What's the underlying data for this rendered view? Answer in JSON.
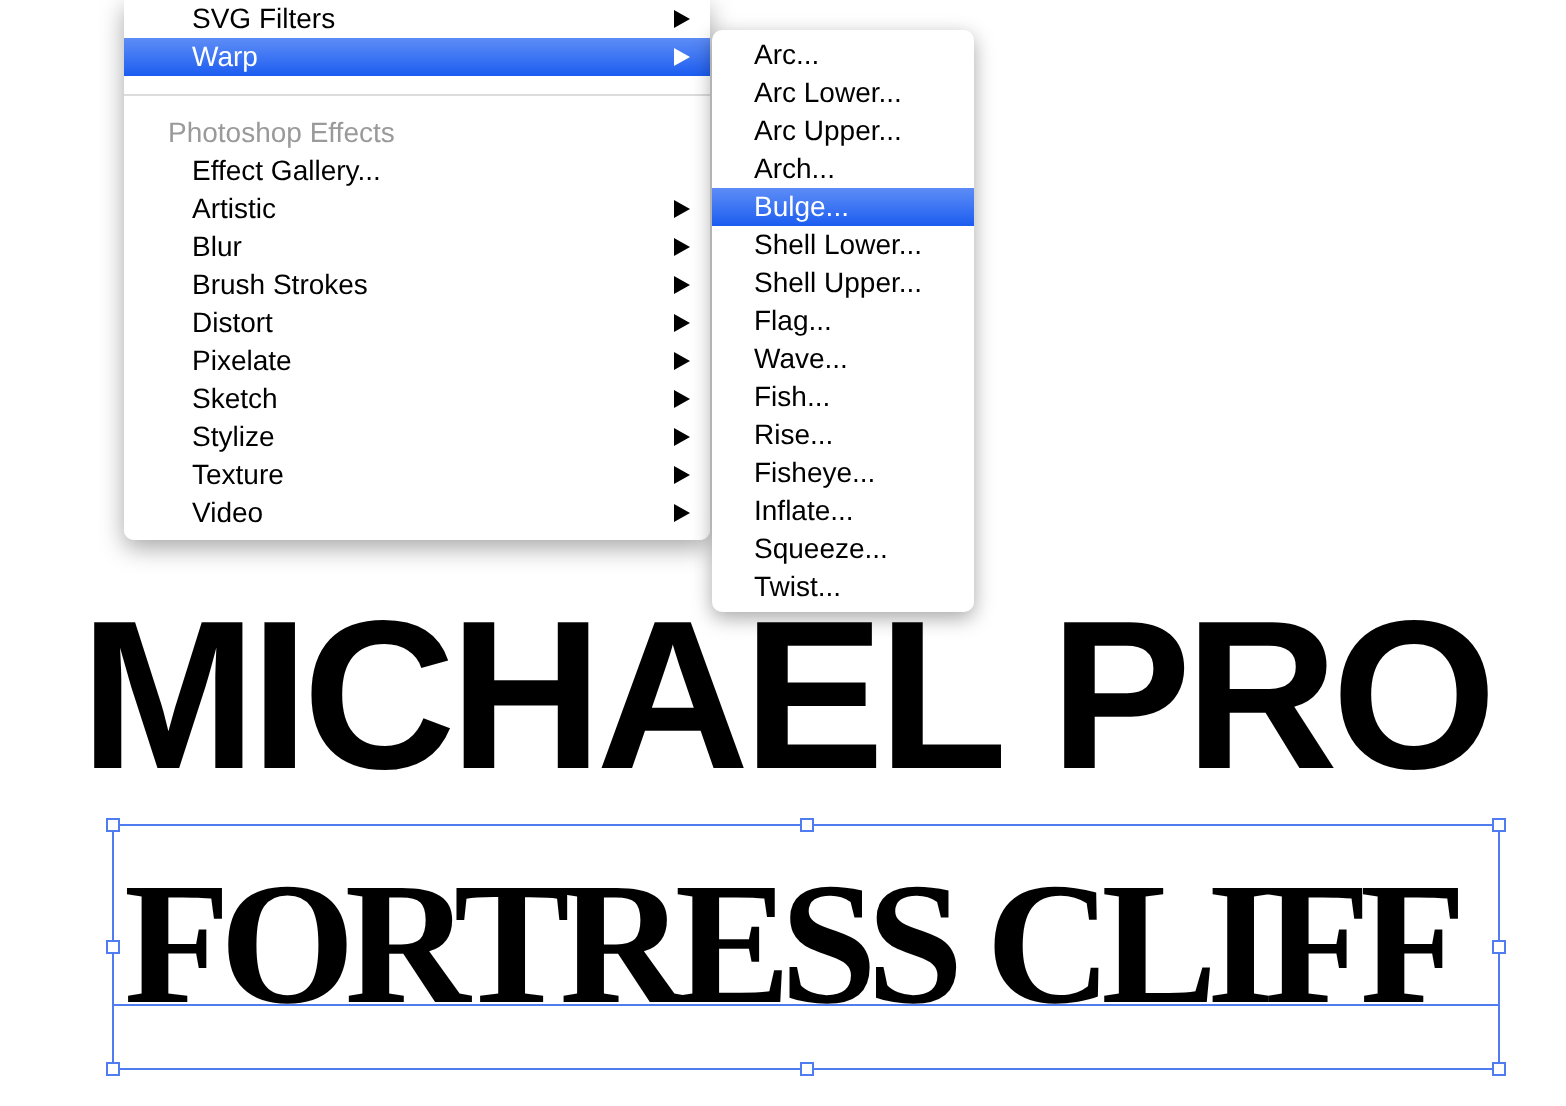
{
  "menu": {
    "items": [
      {
        "kind": "item",
        "label": "SVG Filters",
        "submenu": true,
        "selected": false
      },
      {
        "kind": "item",
        "label": "Warp",
        "submenu": true,
        "selected": true
      },
      {
        "kind": "separator"
      },
      {
        "kind": "header",
        "label": "Photoshop Effects"
      },
      {
        "kind": "item",
        "label": "Effect Gallery...",
        "submenu": false,
        "selected": false
      },
      {
        "kind": "item",
        "label": "Artistic",
        "submenu": true,
        "selected": false
      },
      {
        "kind": "item",
        "label": "Blur",
        "submenu": true,
        "selected": false
      },
      {
        "kind": "item",
        "label": "Brush Strokes",
        "submenu": true,
        "selected": false
      },
      {
        "kind": "item",
        "label": "Distort",
        "submenu": true,
        "selected": false
      },
      {
        "kind": "item",
        "label": "Pixelate",
        "submenu": true,
        "selected": false
      },
      {
        "kind": "item",
        "label": "Sketch",
        "submenu": true,
        "selected": false
      },
      {
        "kind": "item",
        "label": "Stylize",
        "submenu": true,
        "selected": false
      },
      {
        "kind": "item",
        "label": "Texture",
        "submenu": true,
        "selected": false
      },
      {
        "kind": "item",
        "label": "Video",
        "submenu": true,
        "selected": false
      }
    ]
  },
  "submenu": {
    "items": [
      {
        "label": "Arc...",
        "selected": false
      },
      {
        "label": "Arc Lower...",
        "selected": false
      },
      {
        "label": "Arc Upper...",
        "selected": false
      },
      {
        "label": "Arch...",
        "selected": false
      },
      {
        "label": "Bulge...",
        "selected": true
      },
      {
        "label": "Shell Lower...",
        "selected": false
      },
      {
        "label": "Shell Upper...",
        "selected": false
      },
      {
        "label": "Flag...",
        "selected": false
      },
      {
        "label": "Wave...",
        "selected": false
      },
      {
        "label": "Fish...",
        "selected": false
      },
      {
        "label": "Rise...",
        "selected": false
      },
      {
        "label": "Fisheye...",
        "selected": false
      },
      {
        "label": "Inflate...",
        "selected": false
      },
      {
        "label": "Squeeze...",
        "selected": false
      },
      {
        "label": "Twist...",
        "selected": false
      }
    ]
  },
  "canvas": {
    "texts": [
      {
        "kind": "warped",
        "text": "MICHAEL PRO"
      },
      {
        "kind": "selected",
        "text": "FORTRESS CLIFF"
      }
    ]
  }
}
